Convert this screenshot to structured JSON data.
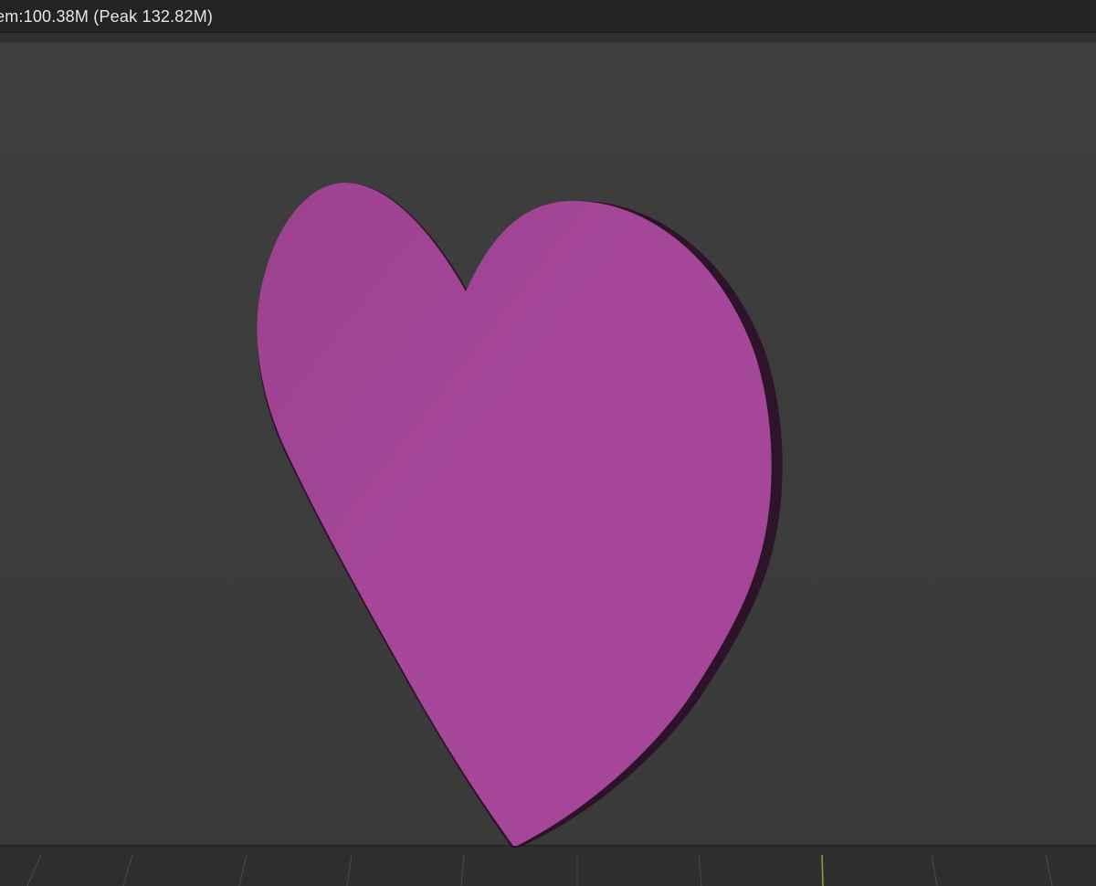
{
  "status_bar": {
    "memory_text": "em:100.38M (Peak 132.82M)"
  },
  "viewport": {
    "background_color": "#3d3d3d",
    "object": {
      "shape": "heart",
      "color": "#a7479a",
      "shadow_color": "#2a0d27"
    },
    "grid": {
      "visible": true,
      "axis_color": "#8fa33a"
    }
  }
}
